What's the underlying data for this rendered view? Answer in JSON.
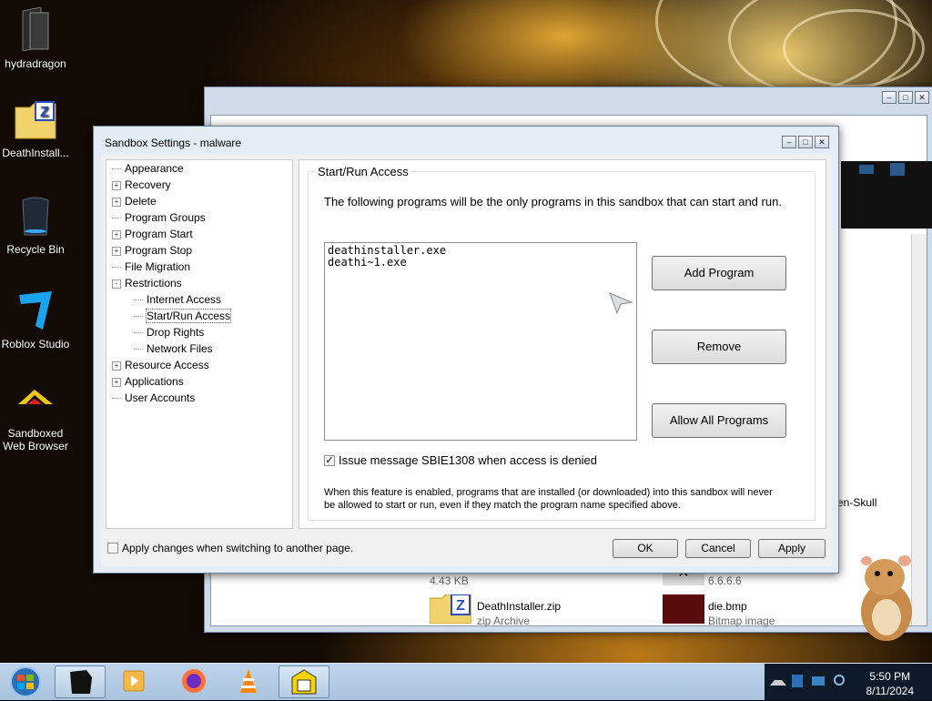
{
  "desktop": {
    "icons": [
      {
        "label": "hydradragon"
      },
      {
        "label": "DeathInstall..."
      },
      {
        "label": "Recycle Bin"
      },
      {
        "label": "Roblox Studio"
      },
      {
        "label": "Sandboxed\nWeb Browser"
      }
    ]
  },
  "explorer": {
    "items": [
      {
        "size": "4.43 KB"
      },
      {
        "name": "DeathInstaller.zip",
        "type": "zip Archive"
      },
      {
        "name": "6.6.6.6"
      },
      {
        "name": "die.bmp",
        "type": "Bitmap image"
      },
      {
        "name": "en-Skull"
      }
    ]
  },
  "dialog": {
    "title": "Sandbox Settings - malware",
    "tree": [
      {
        "label": "Appearance",
        "toggle": ""
      },
      {
        "label": "Recovery",
        "toggle": "+"
      },
      {
        "label": "Delete",
        "toggle": "+"
      },
      {
        "label": "Program Groups",
        "toggle": ""
      },
      {
        "label": "Program Start",
        "toggle": "+"
      },
      {
        "label": "Program Stop",
        "toggle": "+"
      },
      {
        "label": "File Migration",
        "toggle": ""
      },
      {
        "label": "Restrictions",
        "toggle": "-"
      },
      {
        "label": "Internet Access",
        "toggle": ""
      },
      {
        "label": "Start/Run Access",
        "toggle": "",
        "selected": true
      },
      {
        "label": "Drop Rights",
        "toggle": ""
      },
      {
        "label": "Network Files",
        "toggle": ""
      },
      {
        "label": "Resource Access",
        "toggle": "+"
      },
      {
        "label": "Applications",
        "toggle": "+"
      },
      {
        "label": "User Accounts",
        "toggle": ""
      }
    ],
    "panel": {
      "group_title": "Start/Run Access",
      "description": "The following programs will be the only programs in this sandbox that can start and run.",
      "programs": [
        "deathinstaller.exe",
        "deathi~1.exe"
      ],
      "add_label": "Add Program",
      "remove_label": "Remove",
      "allow_all_label": "Allow All Programs",
      "issue_message_label": "Issue message SBIE1308 when access is denied",
      "issue_message_checked": true,
      "note_line1": "When this feature is enabled, programs that are installed (or downloaded) into this sandbox will never",
      "note_line2": "be allowed to start or run, even if they match the program name specified above."
    },
    "apply_on_switch_label": "Apply changes when switching to another page.",
    "ok_label": "OK",
    "cancel_label": "Cancel",
    "apply_label": "Apply"
  },
  "taskbar": {
    "time": "5:50 PM",
    "date": "8/11/2024"
  }
}
